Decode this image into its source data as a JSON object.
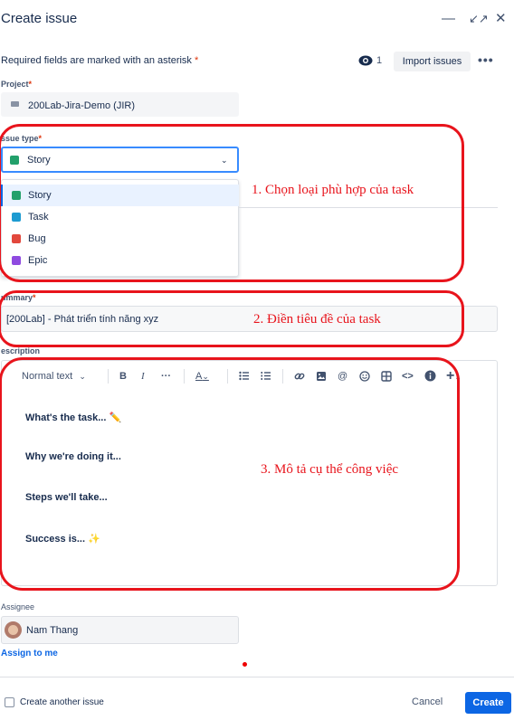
{
  "header": {
    "title": "Create issue",
    "required_note": "Required fields are marked with an asterisk",
    "asterisk": "*",
    "watch_count": "1",
    "import_label": "Import issues",
    "more_label": "•••",
    "minimize_label": "—",
    "expand_label": "↙↗",
    "close_label": "✕"
  },
  "project": {
    "label": "Project",
    "value": "200Lab-Jira-Demo (JIR)"
  },
  "issue_type": {
    "label": "Issue type",
    "label_visible": "ssue type",
    "value": "Story",
    "options": [
      {
        "label": "Story",
        "icon": "story-icon",
        "color": "#22a06b"
      },
      {
        "label": "Task",
        "icon": "task-icon",
        "color": "#1d9bd1"
      },
      {
        "label": "Bug",
        "icon": "bug-icon",
        "color": "#e2483d"
      },
      {
        "label": "Epic",
        "icon": "epic-icon",
        "color": "#8f4ae0"
      }
    ]
  },
  "summary": {
    "label": "Summary",
    "label_visible": "ummary",
    "value": "[200Lab] - Phát triển tính năng xyz"
  },
  "description": {
    "label": "Description",
    "label_visible": "escription",
    "toolbar": {
      "text_style": "Normal text",
      "bold": "B",
      "italic": "I",
      "more": "···",
      "color": "A",
      "plus": "+"
    },
    "lines": [
      "What's the task... ✏️",
      "Why we're doing it...",
      "Steps we'll take...",
      "Success is... ✨"
    ]
  },
  "assignee": {
    "label": "Assignee",
    "value": "Nam Thang",
    "assign_to_me": "Assign to me"
  },
  "footer": {
    "create_another": "Create another issue",
    "cancel": "Cancel",
    "create": "Create"
  },
  "annotations": {
    "step1": "1. Chọn loại phù hợp của task",
    "step2": "2. Điền tiêu đề của task",
    "step3": "3. Mô tả cụ thể công việc",
    "color": "#e8141c"
  },
  "colors": {
    "primary": "#0c66e4",
    "focus": "#388bff",
    "text": "#172b4d"
  }
}
